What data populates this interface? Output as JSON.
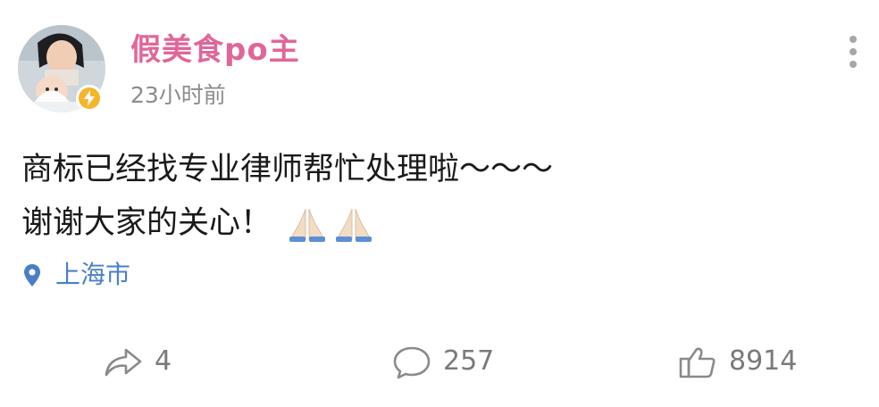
{
  "post": {
    "username": "假美食po主",
    "timestamp": "23小时前",
    "text_lines": [
      "商标已经找专业律师帮忙处理啦～～～",
      "谢谢大家的关心！"
    ],
    "emojis": [
      "folded-hands",
      "folded-hands"
    ],
    "location": "上海市"
  },
  "actions": {
    "share_count": "4",
    "comment_count": "257",
    "like_count": "8914"
  },
  "colors": {
    "username": "#e0669a",
    "timestamp": "#8c8c8c",
    "location": "#4a7fc7",
    "action_text": "#7a7a7a",
    "badge": "#f5b62a"
  },
  "icons": {
    "more": "more-vertical-icon",
    "location": "location-pin-icon",
    "share": "share-icon",
    "comment": "comment-icon",
    "like": "thumbs-up-icon",
    "badge": "lightning-badge-icon"
  }
}
